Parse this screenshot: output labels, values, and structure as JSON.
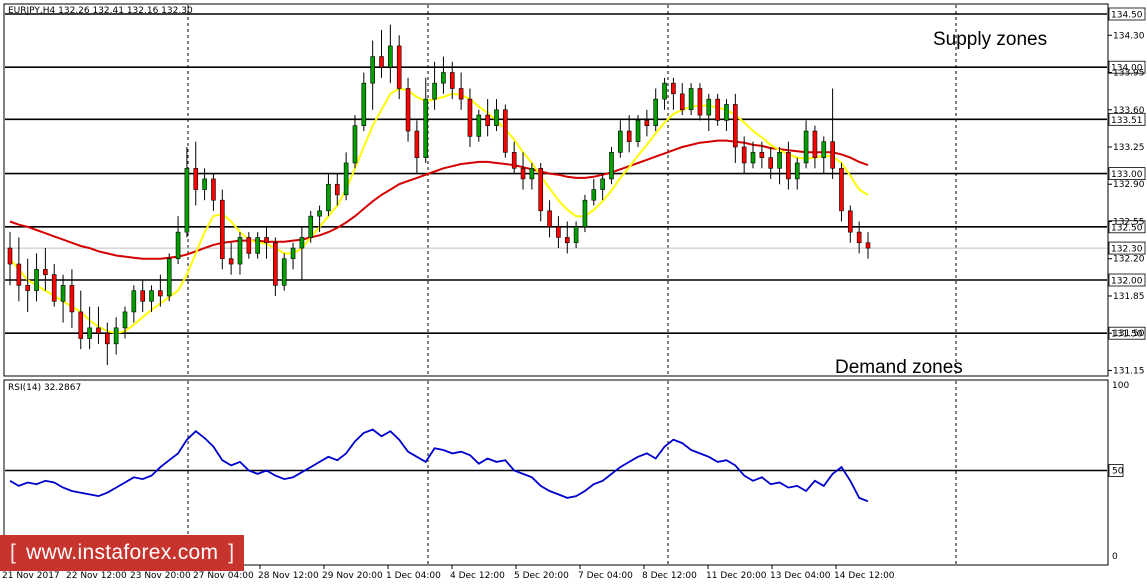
{
  "header": {
    "symbol_info": "EURJPY,H4  132.26 132.41 132.16 132.30",
    "rsi_info": "RSI(14) 32.2867"
  },
  "annotations": {
    "supply": "Supply zones",
    "demand": "Demand zones"
  },
  "logo": {
    "left_bracket": "[",
    "text": "www.instaforex.com",
    "right_bracket": "]"
  },
  "colors": {
    "bull": "#00a000",
    "bear": "#ff0000",
    "ma_fast": "#ffff00",
    "ma_slow": "#d40000",
    "rsi": "#0000cc",
    "level": "#000000"
  },
  "chart_data": [
    {
      "type": "candlestick",
      "symbol": "EURJPY",
      "timeframe": "H4",
      "ylim": [
        131.0,
        134.6
      ],
      "y_ticks": [
        "134.30",
        "133.95",
        "133.60",
        "133.25",
        "132.90",
        "132.55",
        "132.20",
        "131.85",
        "131.50",
        "131.15"
      ],
      "x_ticks": [
        "21 Nov 2017",
        "22 Nov 12:00",
        "23 Nov 20:00",
        "27 Nov 04:00",
        "28 Nov 12:00",
        "29 Nov 20:00",
        "1 Dec 04:00",
        "4 Dec 12:00",
        "5 Dec 20:00",
        "7 Dec 04:00",
        "8 Dec 12:00",
        "11 Dec 20:00",
        "13 Dec 04:00",
        "14 Dec 12:00"
      ],
      "levels": [
        "134.50",
        "134.00",
        "133.51",
        "133.00",
        "132.50",
        "132.00",
        "131.50"
      ],
      "current_price": "132.30",
      "candles_ohlc": [
        [
          132.3,
          132.45,
          131.95,
          132.15
        ],
        [
          132.15,
          132.4,
          131.8,
          131.95
        ],
        [
          131.95,
          132.2,
          131.7,
          131.9
        ],
        [
          131.9,
          132.25,
          131.8,
          132.1
        ],
        [
          132.1,
          132.3,
          131.9,
          132.05
        ],
        [
          132.05,
          132.15,
          131.75,
          131.8
        ],
        [
          131.8,
          132.05,
          131.6,
          131.95
        ],
        [
          131.95,
          132.1,
          131.55,
          131.7
        ],
        [
          131.7,
          131.9,
          131.35,
          131.45
        ],
        [
          131.45,
          131.75,
          131.35,
          131.55
        ],
        [
          131.55,
          131.75,
          131.4,
          131.5
        ],
        [
          131.5,
          131.6,
          131.2,
          131.4
        ],
        [
          131.4,
          131.65,
          131.3,
          131.55
        ],
        [
          131.55,
          131.75,
          131.45,
          131.7
        ],
        [
          131.7,
          131.95,
          131.6,
          131.9
        ],
        [
          131.9,
          132.0,
          131.7,
          131.8
        ],
        [
          131.8,
          131.95,
          131.7,
          131.9
        ],
        [
          131.9,
          132.05,
          131.75,
          131.85
        ],
        [
          131.85,
          132.25,
          131.8,
          132.2
        ],
        [
          132.2,
          132.6,
          132.15,
          132.45
        ],
        [
          132.45,
          133.25,
          132.4,
          133.05
        ],
        [
          133.05,
          133.3,
          132.7,
          132.85
        ],
        [
          132.85,
          133.05,
          132.75,
          132.95
        ],
        [
          132.95,
          133.0,
          132.65,
          132.75
        ],
        [
          132.75,
          132.85,
          132.1,
          132.2
        ],
        [
          132.2,
          132.35,
          132.05,
          132.15
        ],
        [
          132.15,
          132.45,
          132.05,
          132.4
        ],
        [
          132.4,
          132.45,
          132.2,
          132.25
        ],
        [
          132.25,
          132.45,
          132.2,
          132.4
        ],
        [
          132.4,
          132.5,
          132.2,
          132.35
        ],
        [
          132.35,
          132.4,
          131.85,
          131.95
        ],
        [
          131.95,
          132.25,
          131.9,
          132.2
        ],
        [
          132.2,
          132.35,
          132.1,
          132.3
        ],
        [
          132.3,
          132.5,
          132.0,
          132.4
        ],
        [
          132.4,
          132.65,
          132.35,
          132.6
        ],
        [
          132.6,
          132.7,
          132.45,
          132.65
        ],
        [
          132.65,
          133.0,
          132.6,
          132.9
        ],
        [
          132.9,
          133.0,
          132.7,
          132.8
        ],
        [
          132.8,
          133.2,
          132.75,
          133.1
        ],
        [
          133.1,
          133.55,
          133.05,
          133.45
        ],
        [
          133.45,
          133.95,
          133.4,
          133.85
        ],
        [
          133.85,
          134.25,
          133.6,
          134.1
        ],
        [
          134.1,
          134.35,
          133.9,
          134.0
        ],
        [
          134.0,
          134.4,
          133.85,
          134.2
        ],
        [
          134.2,
          134.3,
          133.7,
          133.8
        ],
        [
          133.8,
          133.9,
          133.3,
          133.4
        ],
        [
          133.4,
          133.5,
          133.0,
          133.15
        ],
        [
          133.15,
          133.9,
          133.1,
          133.7
        ],
        [
          133.7,
          134.05,
          133.6,
          133.85
        ],
        [
          133.85,
          134.1,
          133.75,
          133.95
        ],
        [
          133.95,
          134.05,
          133.7,
          133.8
        ],
        [
          133.8,
          133.95,
          133.6,
          133.7
        ],
        [
          133.7,
          133.8,
          133.25,
          133.35
        ],
        [
          133.35,
          133.6,
          133.3,
          133.55
        ],
        [
          133.55,
          133.7,
          133.35,
          133.45
        ],
        [
          133.45,
          133.7,
          133.4,
          133.6
        ],
        [
          133.6,
          133.65,
          133.15,
          133.2
        ],
        [
          133.2,
          133.3,
          133.0,
          133.05
        ],
        [
          133.05,
          133.2,
          132.85,
          132.95
        ],
        [
          132.95,
          133.1,
          132.85,
          133.05
        ],
        [
          133.05,
          133.1,
          132.55,
          132.65
        ],
        [
          132.65,
          132.75,
          132.4,
          132.5
        ],
        [
          132.5,
          132.6,
          132.3,
          132.4
        ],
        [
          132.4,
          132.55,
          132.25,
          132.35
        ],
        [
          132.35,
          132.55,
          132.3,
          132.5
        ],
        [
          132.5,
          132.8,
          132.45,
          132.75
        ],
        [
          132.75,
          132.95,
          132.7,
          132.85
        ],
        [
          132.85,
          133.0,
          132.75,
          132.95
        ],
        [
          132.95,
          133.25,
          132.9,
          133.2
        ],
        [
          133.2,
          133.5,
          133.15,
          133.4
        ],
        [
          133.4,
          133.55,
          133.2,
          133.3
        ],
        [
          133.3,
          133.55,
          133.25,
          133.5
        ],
        [
          133.5,
          133.6,
          133.35,
          133.45
        ],
        [
          133.45,
          133.8,
          133.4,
          133.7
        ],
        [
          133.7,
          133.9,
          133.6,
          133.85
        ],
        [
          133.85,
          133.9,
          133.6,
          133.75
        ],
        [
          133.75,
          133.85,
          133.55,
          133.6
        ],
        [
          133.6,
          133.85,
          133.55,
          133.8
        ],
        [
          133.8,
          133.85,
          133.5,
          133.55
        ],
        [
          133.55,
          133.75,
          133.4,
          133.7
        ],
        [
          133.7,
          133.75,
          133.45,
          133.5
        ],
        [
          133.5,
          133.7,
          133.4,
          133.65
        ],
        [
          133.65,
          133.75,
          133.1,
          133.25
        ],
        [
          133.25,
          133.35,
          133.0,
          133.1
        ],
        [
          133.1,
          133.3,
          133.05,
          133.2
        ],
        [
          133.2,
          133.3,
          133.05,
          133.15
        ],
        [
          133.15,
          133.25,
          132.95,
          133.05
        ],
        [
          133.05,
          133.25,
          132.9,
          133.2
        ],
        [
          133.2,
          133.3,
          132.85,
          132.95
        ],
        [
          132.95,
          133.15,
          132.85,
          133.1
        ],
        [
          133.1,
          133.5,
          133.05,
          133.4
        ],
        [
          133.4,
          133.45,
          133.05,
          133.15
        ],
        [
          133.15,
          133.35,
          133.0,
          133.3
        ],
        [
          133.3,
          133.8,
          132.95,
          133.05
        ],
        [
          133.05,
          133.1,
          132.55,
          132.65
        ],
        [
          132.65,
          132.7,
          132.35,
          132.45
        ],
        [
          132.45,
          132.55,
          132.25,
          132.35
        ],
        [
          132.35,
          132.45,
          132.2,
          132.3
        ]
      ],
      "sma_fast": [
        132.2,
        132.1,
        132.0,
        131.95,
        131.9,
        131.85,
        131.8,
        131.75,
        131.7,
        131.62,
        131.56,
        131.52,
        131.5,
        131.52,
        131.58,
        131.65,
        131.72,
        131.78,
        131.84,
        131.9,
        132.05,
        132.25,
        132.45,
        132.6,
        132.62,
        132.55,
        132.45,
        132.38,
        132.35,
        132.34,
        132.3,
        132.25,
        132.25,
        132.3,
        132.4,
        132.5,
        132.6,
        132.7,
        132.85,
        133.05,
        133.25,
        133.45,
        133.6,
        133.75,
        133.8,
        133.78,
        133.72,
        133.68,
        133.7,
        133.72,
        133.75,
        133.74,
        133.7,
        133.63,
        133.57,
        133.5,
        133.42,
        133.32,
        133.2,
        133.1,
        132.98,
        132.86,
        132.75,
        132.66,
        132.6,
        132.6,
        132.66,
        132.74,
        132.84,
        132.96,
        133.06,
        133.17,
        133.27,
        133.38,
        133.48,
        133.56,
        133.6,
        133.63,
        133.64,
        133.64,
        133.62,
        133.6,
        133.55,
        133.48,
        133.4,
        133.34,
        133.27,
        133.22,
        133.18,
        133.15,
        133.14,
        133.15,
        133.17,
        133.16,
        133.1,
        132.98,
        132.85,
        132.8
      ],
      "sma_slow": [
        132.55,
        132.52,
        132.5,
        132.47,
        132.44,
        132.41,
        132.38,
        132.35,
        132.32,
        132.3,
        132.27,
        132.25,
        132.23,
        132.22,
        132.21,
        132.2,
        132.2,
        132.2,
        132.21,
        132.22,
        132.24,
        132.27,
        132.3,
        132.33,
        132.35,
        132.36,
        132.37,
        132.37,
        132.37,
        132.36,
        132.36,
        132.36,
        132.37,
        132.38,
        132.4,
        132.42,
        132.45,
        132.49,
        132.54,
        132.6,
        132.67,
        132.74,
        132.8,
        132.85,
        132.9,
        132.93,
        132.96,
        132.99,
        133.02,
        133.05,
        133.07,
        133.09,
        133.1,
        133.11,
        133.11,
        133.1,
        133.09,
        133.08,
        133.06,
        133.04,
        133.02,
        133.0,
        132.99,
        132.97,
        132.96,
        132.96,
        132.97,
        132.99,
        133.01,
        133.04,
        133.07,
        133.1,
        133.13,
        133.16,
        133.19,
        133.22,
        133.25,
        133.27,
        133.29,
        133.3,
        133.31,
        133.31,
        133.3,
        133.29,
        133.27,
        133.26,
        133.24,
        133.23,
        133.22,
        133.21,
        133.2,
        133.2,
        133.2,
        133.2,
        133.18,
        133.15,
        133.11,
        133.08
      ]
    },
    {
      "type": "line",
      "title": "RSI(14) 32.2867",
      "ylim": [
        0,
        100
      ],
      "y_ticks": [
        "100",
        "50",
        "0"
      ],
      "reference_level": 50,
      "values": [
        44,
        41,
        43,
        42,
        44,
        43,
        40,
        38,
        37,
        36,
        35,
        37,
        40,
        43,
        46,
        45,
        47,
        52,
        56,
        60,
        68,
        73,
        69,
        64,
        56,
        53,
        55,
        50,
        48,
        50,
        47,
        45,
        46,
        49,
        52,
        55,
        58,
        56,
        60,
        67,
        72,
        74,
        70,
        73,
        68,
        61,
        58,
        55,
        63,
        62,
        60,
        61,
        59,
        54,
        57,
        55,
        56,
        50,
        48,
        46,
        41,
        38,
        36,
        34,
        35,
        38,
        42,
        44,
        48,
        52,
        55,
        58,
        60,
        57,
        64,
        68,
        66,
        62,
        60,
        58,
        55,
        56,
        53,
        47,
        44,
        46,
        42,
        43,
        40,
        41,
        38,
        44,
        41,
        48,
        52,
        44,
        34,
        32
      ]
    }
  ]
}
